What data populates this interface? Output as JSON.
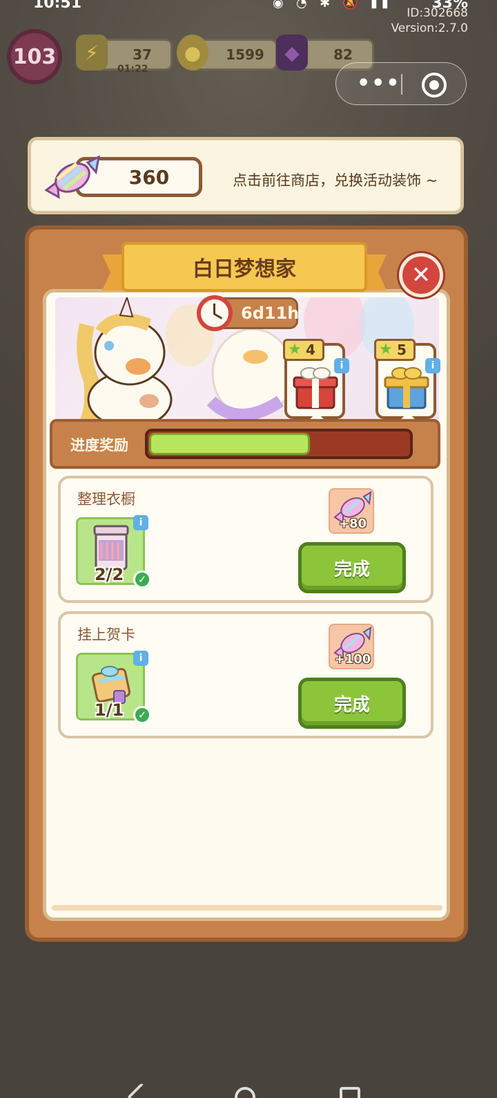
{
  "status": {
    "time": "10:51",
    "battery": "33%"
  },
  "build": {
    "id": "ID:302668",
    "version": "Version:2.7.0"
  },
  "hud": {
    "level": "103",
    "energy": "37",
    "energy_timer": "01:22",
    "coins": "1599",
    "gems": "82"
  },
  "event_banner": {
    "candy_count": "360",
    "hint": "点击前往商店，兑换活动装饰 ~"
  },
  "modal": {
    "title": "白日梦想家",
    "timer": "6d11h",
    "progress_label": "进度奖励",
    "progress_fraction": 0.62,
    "rewards": [
      {
        "stars": "4",
        "icon": "red-gift-box-icon"
      },
      {
        "stars": "5",
        "icon": "blue-gift-box-icon"
      }
    ],
    "tasks": [
      {
        "title": "整理衣橱",
        "progress": "2/2",
        "reward": "+80",
        "button": "完成",
        "icon": "wardrobe-icon"
      },
      {
        "title": "挂上贺卡",
        "progress": "1/1",
        "reward": "+100",
        "button": "完成",
        "icon": "greeting-card-gift-icon"
      }
    ]
  },
  "colors": {
    "modal_frame": "#c7824c",
    "progress_fill": "#b6e65b",
    "button_green": "#8cc43a",
    "close_red": "#d2463e"
  }
}
